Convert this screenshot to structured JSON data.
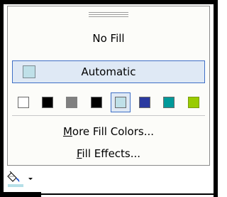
{
  "menu": {
    "no_fill": "No Fill",
    "automatic": "Automatic",
    "more_fill_colors_prefix": "",
    "more_fill_colors_accel": "M",
    "more_fill_colors_rest": "ore Fill Colors...",
    "fill_effects_accel": "F",
    "fill_effects_rest": "ill Effects..."
  },
  "swatches": [
    {
      "name": "white",
      "color": "#ffffff"
    },
    {
      "name": "black",
      "color": "#000000"
    },
    {
      "name": "gray",
      "color": "#808080"
    },
    {
      "name": "black",
      "color": "#000000"
    },
    {
      "name": "light-turquoise",
      "color": "#bfe0e8",
      "selected": true
    },
    {
      "name": "blue",
      "color": "#2b3aa0"
    },
    {
      "name": "teal",
      "color": "#009999"
    },
    {
      "name": "green",
      "color": "#99cc00"
    }
  ],
  "colors": {
    "highlight": "#dfe9f5",
    "highlight_border": "#3f6fc6",
    "current_fill": "#b5dfe8"
  },
  "toolbar": {
    "icon": "fill-bucket-icon",
    "arrow_icon": "chevron-down-icon"
  }
}
